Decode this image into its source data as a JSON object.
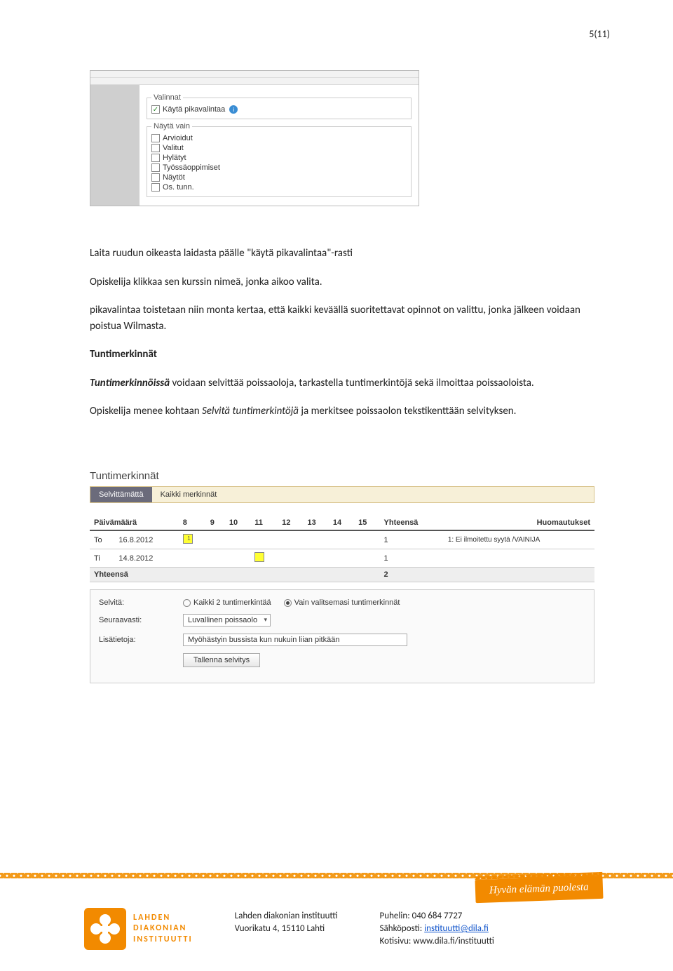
{
  "page_num": "5(11)",
  "top_shot": {
    "fs1": {
      "legend": "Valinnat",
      "checkbox_label": "Käytä pikavalintaa"
    },
    "fs2": {
      "legend": "Näytä vain",
      "options": [
        "Arvioidut",
        "Valitut",
        "Hylätyt",
        "Työssäoppimiset",
        "Näytöt",
        "Os. tunn."
      ]
    }
  },
  "body": {
    "p1": "Laita ruudun oikeasta laidasta päälle \"käytä pikavalintaa\"-rasti",
    "p2": "Opiskelija klikkaa sen kurssin nimeä, jonka aikoo valita.",
    "p3": "pikavalintaa toistetaan niin monta kertaa, että kaikki keväällä suoritettavat opinnot on valittu, jonka jälkeen voidaan poistua Wilmasta.",
    "h1": "Tuntimerkinnät",
    "p4a": "Tuntimerkinnöissä",
    "p4b": " voidaan selvittää poissaoloja, tarkastella tuntimerkintöjä sekä ilmoittaa poissaoloista.",
    "p5a": "Opiskelija menee kohtaan ",
    "p5b": "Selvitä tuntimerkintöjä",
    "p5c": " ja merkitsee poissaolon tekstikenttään selvityksen."
  },
  "tm": {
    "title": "Tuntimerkinnät",
    "tab_active": "Selvittämättä",
    "tab_other": "Kaikki merkinnät",
    "col_date": "Päivämäärä",
    "cols_hours": [
      "8",
      "9",
      "10",
      "11",
      "12",
      "13",
      "14",
      "15"
    ],
    "col_total": "Yhteensä",
    "col_notes": "Huomautukset",
    "rows": [
      {
        "day": "To",
        "date": "16.8.2012",
        "mark_col": 0,
        "hl": true,
        "num": true,
        "total": "1",
        "note": "1: Ei ilmoitettu syytä /VAINIJA"
      },
      {
        "day": "Ti",
        "date": "14.8.2012",
        "mark_col": 3,
        "hl": true,
        "num": false,
        "total": "1",
        "note": ""
      }
    ],
    "row_total_label": "Yhteensä",
    "row_total_value": "2",
    "form": {
      "selvita_label": "Selvitä:",
      "radio1": "Kaikki 2 tuntimerkintää",
      "radio2": "Vain valitsemasi tuntimerkinnät",
      "seuraavasti_label": "Seuraavasti:",
      "select_value": "Luvallinen poissaolo",
      "lisatietoja_label": "Lisätietoja:",
      "text_value": "Myöhästyin bussista kun nukuin liian pitkään",
      "button": "Tallenna selvitys"
    }
  },
  "footer": {
    "tagline": "Hyvän elämän puolesta",
    "logo_l1": "LAHDEN",
    "logo_l2": "DIAKONIAN",
    "logo_l3": "INSTITUUTTI",
    "col1_l1": "Lahden diakonian instituutti",
    "col1_l2": "Vuorikatu 4, 15110 Lahti",
    "col2_l1": "Puhelin: 040 684 7727",
    "col2_l2a": "Sähköposti: ",
    "col2_l2b": "instituutti@dila.fi",
    "col2_l3": "Kotisivu: www.dila.fi/instituutti"
  }
}
